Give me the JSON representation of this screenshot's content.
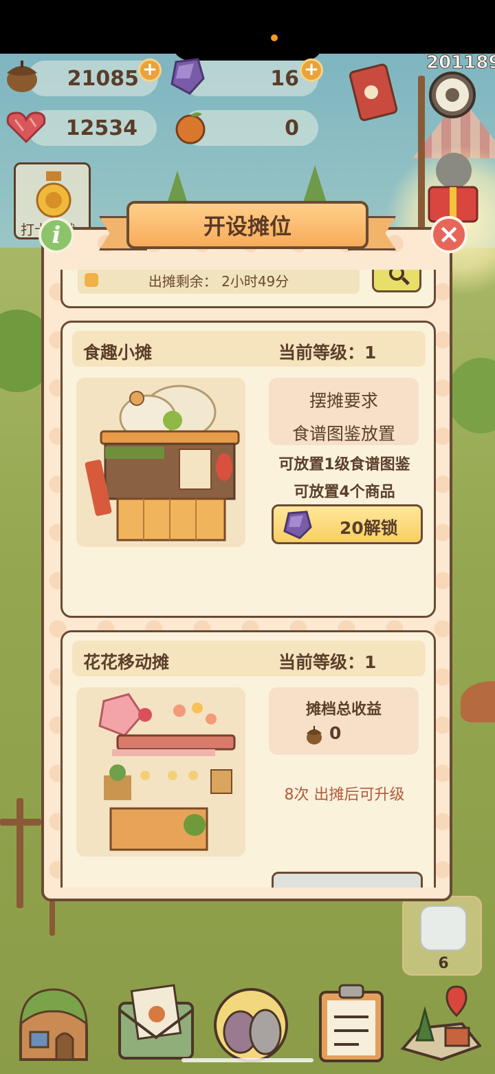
{
  "resources": {
    "acorns": "21085",
    "gems": "16",
    "hearts": "12534",
    "oranges": "0",
    "plus_symbol": "+",
    "corner_number": "201189"
  },
  "left_badge": {
    "label": "打卡成就",
    "info_symbol": "i"
  },
  "dialog": {
    "title": "开设摊位",
    "close_symbol": "×",
    "timer_text": "出摊剩余： 2小时49分",
    "stalls": [
      {
        "name": "食趣小摊",
        "level": "当前等级：1",
        "requirement_title": "摆摊要求",
        "requirement_item": "食谱图鉴放置",
        "info_line_1": "可放置1级食谱图鉴",
        "info_line_2": "可放置4个商品",
        "unlock_label": "20解锁"
      },
      {
        "name": "花花移动摊",
        "level": "当前等级：1",
        "earnings_title": "摊档总收益",
        "earnings_value": "0",
        "upgrade_note": "8次 出摊后可升级"
      }
    ]
  },
  "side_box": {
    "count": "6"
  },
  "colors": {
    "dialog_bg": "#fde8d1",
    "border": "#6a4a33",
    "ribbon": "#f7ac5b",
    "unlock_button": "#f7cf63",
    "close_button": "#e6665a",
    "info_button": "#8cc46b",
    "note_text": "#b05b3b"
  },
  "icons": {
    "acorn": "acorn-icon",
    "gem": "purple-gem-icon",
    "heart": "heart-icon",
    "orange": "orange-icon",
    "close": "close-icon",
    "info": "info-icon",
    "search": "search-icon"
  }
}
